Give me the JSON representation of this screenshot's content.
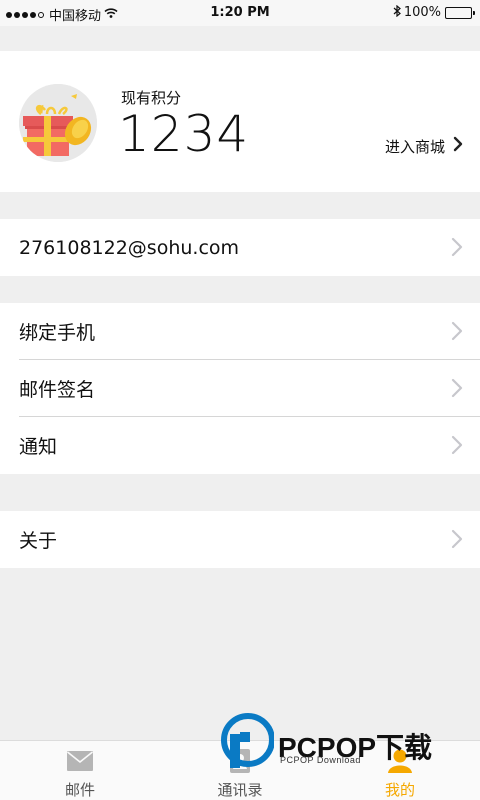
{
  "status_bar": {
    "carrier": "中国移动",
    "time": "1:20 PM",
    "battery": "100%",
    "battery_level": 1.0
  },
  "points": {
    "label": "现有积分",
    "value": "1234",
    "mall_link": "进入商城"
  },
  "account": {
    "email": "276108122@sohu.com"
  },
  "settings": {
    "items": [
      {
        "label": "绑定手机"
      },
      {
        "label": "邮件签名"
      },
      {
        "label": "通知"
      }
    ]
  },
  "about": {
    "label": "关于"
  },
  "tab_bar": {
    "tabs": [
      {
        "label": "邮件",
        "icon": "mail-icon"
      },
      {
        "label": "通讯录",
        "icon": "contacts-icon"
      },
      {
        "label": "我的",
        "icon": "profile-icon"
      }
    ],
    "active_color": "#f5a800"
  },
  "watermark": {
    "title": "PCPOP下载",
    "subtitle": "PCPOP Download"
  }
}
